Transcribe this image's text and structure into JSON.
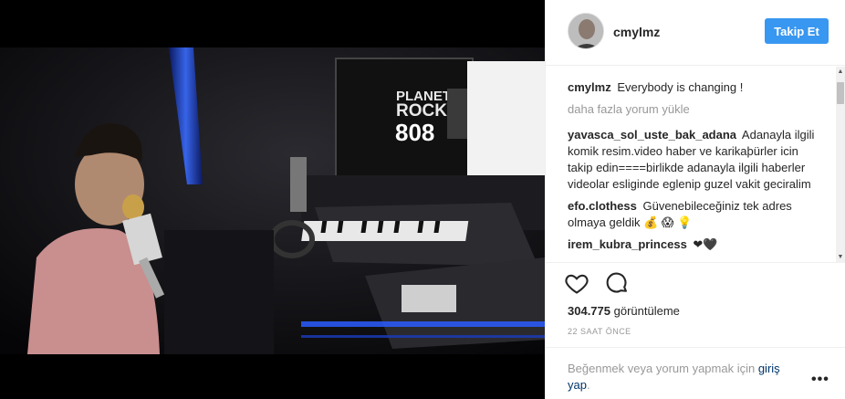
{
  "header": {
    "username": "cmylmz",
    "follow_label": "Takip Et"
  },
  "caption": {
    "username": "cmylmz",
    "text": "Everybody is changing !"
  },
  "load_more_label": "daha fazla yorum yükle",
  "comments": [
    {
      "username": "yavasca_sol_uste_bak_adana",
      "text": "Adanayla ilgili komik resim.video haber ve karikaþürler icin takip edin====birlikde adanayla ilgili haberler videolar esliginde eglenip guzel vakit geciralim"
    },
    {
      "username": "efo.clothess",
      "text": "Güvenebileceğiniz tek adres olmaya geldik 💰 😱 💡"
    },
    {
      "username": "irem_kubra_princess",
      "text": "❤🖤"
    }
  ],
  "views": {
    "count": "304.775",
    "suffix": "görüntüleme"
  },
  "timestamp": "22 SAAT ÖNCE",
  "footer": {
    "prefix": "Beğenmek veya yorum yapmak için",
    "link": "giriş yap",
    "suffix": ".",
    "more_label": "•••"
  },
  "media": {
    "screen_line1": "PLANET",
    "screen_line2": "ROCK",
    "screen_line3": "808"
  },
  "colors": {
    "accent": "#3897f0",
    "link": "#003569",
    "muted": "#999999",
    "text": "#262626"
  },
  "icons": [
    "heart-icon",
    "comment-icon",
    "more-options-icon"
  ]
}
